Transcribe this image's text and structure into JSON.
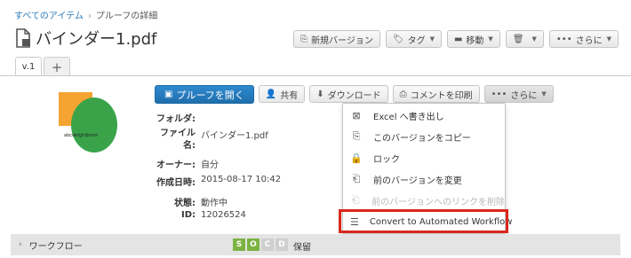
{
  "breadcrumb": {
    "root": "すべてのアイテム",
    "current": "プルーフの詳細"
  },
  "title": "バインダー1.pdf",
  "top_actions": [
    {
      "label": "新規バージョン",
      "icon": "copy-icon"
    },
    {
      "label": "タグ",
      "icon": "tag-icon"
    },
    {
      "label": "移動",
      "icon": "folder-icon"
    },
    {
      "label": "",
      "icon": "trash-icon"
    },
    {
      "label": "さらに",
      "icon": "more-icon"
    }
  ],
  "tabs": {
    "version": "v.1",
    "add": "+"
  },
  "thumbnail": {
    "text": "abcdefghijklmn"
  },
  "actions": {
    "open": "プルーフを開く",
    "share": "共有",
    "download": "ダウンロード",
    "print_comments": "コメントを印刷",
    "more": "さらに"
  },
  "properties": {
    "folder_label": "フォルダ:",
    "folder_value": "",
    "name_label_1": "ファイル",
    "name_label_2": "名:",
    "name_value": "バインダー1.pdf",
    "owner_label": "オーナー:",
    "owner_value": "自分",
    "created_label": "作成日時:",
    "created_value": "2015-08-17 10:42",
    "status_label": "状態:",
    "status_value": "動作中",
    "id_label": "ID:",
    "id_value": "12026524"
  },
  "menu": [
    {
      "label": "Excel へ書き出し",
      "icon": "excel-export-icon",
      "enabled": true
    },
    {
      "label": "このバージョンをコピー",
      "icon": "copy-icon",
      "enabled": true
    },
    {
      "label": "ロック",
      "icon": "lock-icon",
      "enabled": true
    },
    {
      "label": "前のバージョンを変更",
      "icon": "replace-icon",
      "enabled": true
    },
    {
      "label": "前のバージョンへのリンクを削除",
      "icon": "unlink-icon",
      "enabled": false
    },
    {
      "label": "Convert to Automated Workflow",
      "icon": "workflow-icon",
      "enabled": true
    }
  ],
  "workflow": {
    "label": "ワークフロー",
    "stages": [
      "S",
      "O",
      "C",
      "D"
    ],
    "status": "保留"
  },
  "colors": {
    "primary": "#2a7ab8",
    "highlight": "#d9281c",
    "stage_active": "#7cb342"
  }
}
